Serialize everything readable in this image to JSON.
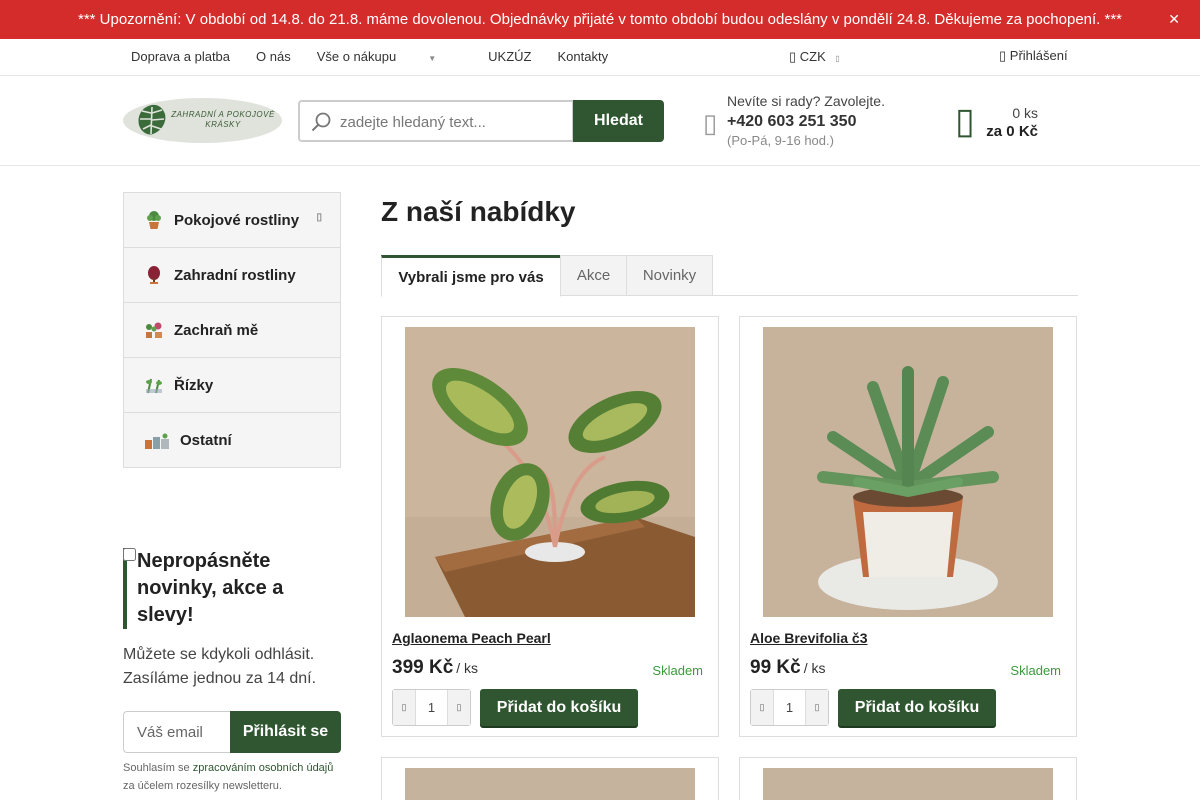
{
  "notice": {
    "text": "*** Upozornění: V období od 14.8. do 21.8. máme dovolenou. Objednávky přijaté v tomto období budou odeslány v pondělí 24.8. Děkujeme za pochopení. ***",
    "close_icon": "close-icon"
  },
  "topnav": {
    "links": [
      "Doprava a platba",
      "O nás",
      "Vše o nákupu",
      "UKZÚZ",
      "Kontakty"
    ],
    "currency": "CZK",
    "login": "Přihlášení"
  },
  "header": {
    "logo_text": "ZAHRADNÍ A POKOJOVÉ KRÁSKY",
    "search_placeholder": "zadejte hledaný text...",
    "search_button": "Hledat",
    "help_question": "Nevíte si rady? Zavolejte.",
    "phone": "+420 603 251 350",
    "hours": "(Po-Pá, 9-16 hod.)",
    "cart_count": "0 ks",
    "cart_total": "za 0 Kč"
  },
  "sidebar": {
    "items": [
      {
        "label": "Pokojové rostliny",
        "icon": "potted-plant-icon"
      },
      {
        "label": "Zahradní rostliny",
        "icon": "tree-icon"
      },
      {
        "label": "Zachraň mě",
        "icon": "plants-group-icon"
      },
      {
        "label": "Řízky",
        "icon": "cuttings-icon"
      },
      {
        "label": "Ostatní",
        "icon": "pots-icon"
      }
    ]
  },
  "newsletter": {
    "title": "Nepropásněte novinky, akce a slevy!",
    "text": "Můžete se kdykoli odhlásit. Zasíláme jednou za 14 dní.",
    "email_placeholder": "Váš email",
    "button": "Přihlásit se",
    "consent_pre": "Souhlasím se",
    "consent_link": "zpracováním osobních údajů",
    "consent_post": "za účelem rozesílky newsletteru."
  },
  "main": {
    "title": "Z naší nabídky",
    "tabs": [
      "Vybrali jsme pro vás",
      "Akce",
      "Novinky"
    ],
    "products": [
      {
        "name": "Aglaonema Peach Pearl",
        "price": "399 Kč",
        "unit": "/ ks",
        "stock": "Skladem",
        "qty": "1",
        "add": "Přidat do košíku"
      },
      {
        "name": "Aloe Brevifolia č3",
        "price": "99 Kč",
        "unit": "/ ks",
        "stock": "Skladem",
        "qty": "1",
        "add": "Přidat do košíku"
      }
    ]
  },
  "colors": {
    "brand_green": "#2f5630",
    "notice_red": "#d42c2a",
    "stock_green": "#3a9a3a"
  }
}
